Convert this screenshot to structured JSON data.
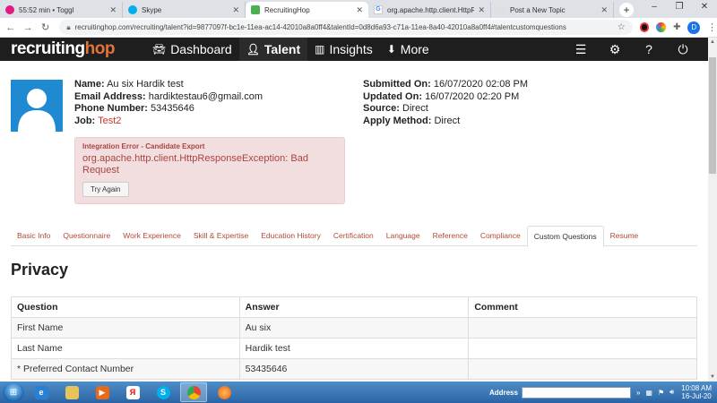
{
  "browser": {
    "tabs": [
      {
        "label": "55:52 min • Toggl",
        "fav_color": "#e01b84"
      },
      {
        "label": "Skype",
        "fav_color": "#00aff0"
      },
      {
        "label": "RecruitingHop",
        "fav_color": "#4caf50"
      },
      {
        "label": "org.apache.http.client.HttpResp",
        "fav_color": "#ffffff"
      },
      {
        "label": "Post a New Topic",
        "fav_color": "#e0e0e0"
      }
    ],
    "url": "recruitinghop.com/recruiting/talent?id=9877097f-bc1e-11ea-ac14-42010a8a0ff4&talentId=0d8d6a93-c71a-11ea-8a40-42010a8a0ff4#talentcustomquestions",
    "profile_initial": "D"
  },
  "app": {
    "logo_main": "recruiting",
    "logo_accent": "hop",
    "nav": [
      {
        "label": "Dashboard",
        "icon": "car-icon"
      },
      {
        "label": "Talent",
        "icon": "user-icon"
      },
      {
        "label": "Insights",
        "icon": "bar-chart-icon"
      },
      {
        "label": "More",
        "icon": "arrow-circle-down-icon"
      }
    ],
    "active_nav": "Talent"
  },
  "candidate": {
    "name_label": "Name:",
    "name": "Au six Hardik test",
    "email_label": "Email Address:",
    "email": "hardiktestau6@gmail.com",
    "phone_label": "Phone Number:",
    "phone": "53435646",
    "job_label": "Job:",
    "job": "Test2",
    "submitted_label": "Submitted On:",
    "submitted": "16/07/2020 02:08 PM",
    "updated_label": "Updated On:",
    "updated": "16/07/2020 02:20 PM",
    "source_label": "Source:",
    "source": "Direct",
    "apply_label": "Apply Method:",
    "apply": "Direct"
  },
  "error": {
    "title": "Integration Error - Candidate Export",
    "message": "org.apache.http.client.HttpResponseException: Bad Request",
    "button": "Try Again"
  },
  "profile_tabs": [
    "Basic Info",
    "Questionnaire",
    "Work Experience",
    "Skill & Expertise",
    "Education History",
    "Certification",
    "Language",
    "Reference",
    "Compliance",
    "Custom Questions",
    "Resume"
  ],
  "active_profile_tab": "Custom Questions",
  "section_title": "Privacy",
  "table": {
    "headers": [
      "Question",
      "Answer",
      "Comment"
    ],
    "rows": [
      [
        "First Name",
        "Au six",
        ""
      ],
      [
        "Last Name",
        "Hardik test",
        ""
      ],
      [
        "* Preferred Contact Number",
        "53435646",
        ""
      ]
    ]
  },
  "taskbar": {
    "address_label": "Address",
    "time": "10:08 AM",
    "date": "16-Jul-20"
  }
}
